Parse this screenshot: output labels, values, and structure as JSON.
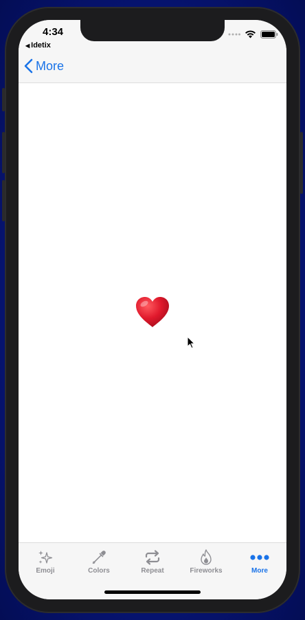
{
  "status_bar": {
    "time": "4:34",
    "back_app": "Idetix"
  },
  "nav_bar": {
    "back_label": "More"
  },
  "content": {
    "emoji": "heart-emoji"
  },
  "tab_bar": {
    "tabs": [
      {
        "label": "Emoji",
        "icon": "sparkles-icon",
        "active": false
      },
      {
        "label": "Colors",
        "icon": "eyedropper-icon",
        "active": false
      },
      {
        "label": "Repeat",
        "icon": "repeat-icon",
        "active": false
      },
      {
        "label": "Fireworks",
        "icon": "flame-icon",
        "active": false
      },
      {
        "label": "More",
        "icon": "ellipsis-icon",
        "active": true
      }
    ]
  },
  "colors": {
    "accent": "#1a73e8",
    "inactive": "#8e8e93",
    "heart": "#e0192c"
  }
}
